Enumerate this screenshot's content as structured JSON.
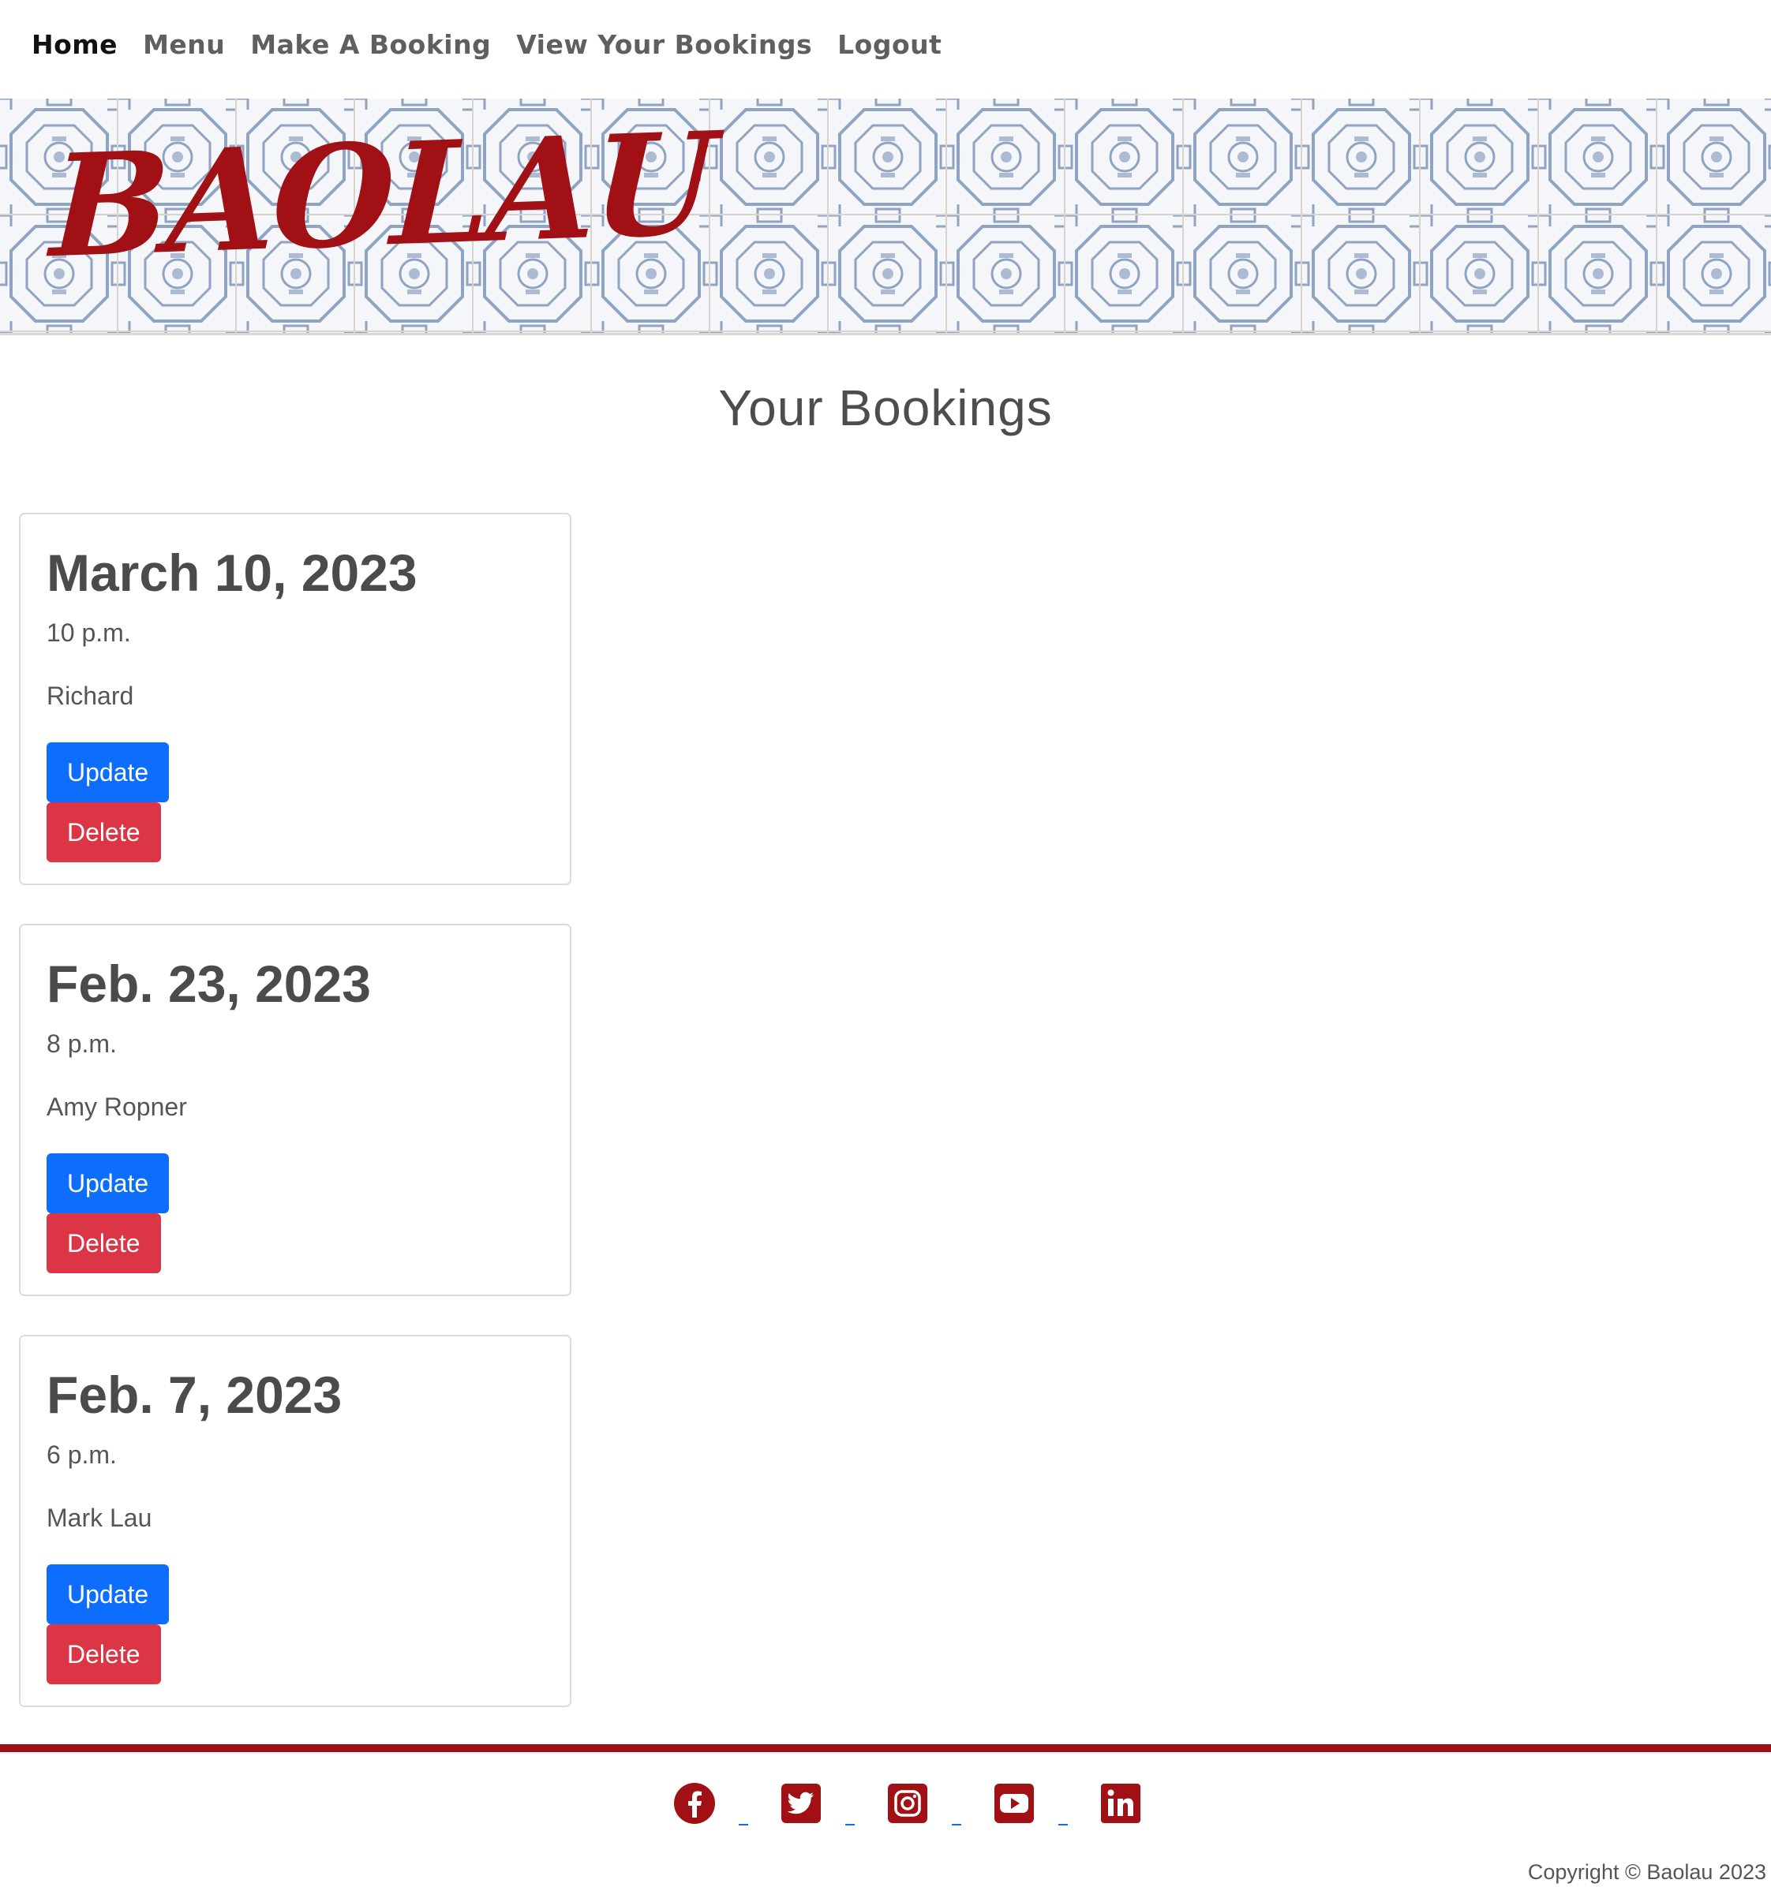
{
  "nav": {
    "items": [
      {
        "label": "Home",
        "active": true
      },
      {
        "label": "Menu",
        "active": false
      },
      {
        "label": "Make A Booking",
        "active": false
      },
      {
        "label": "View Your Bookings",
        "active": false
      },
      {
        "label": "Logout",
        "active": false
      }
    ]
  },
  "banner": {
    "logo_text": "BAOLAU",
    "logo_color": "#a01014",
    "tile_color": "#8fa3c2"
  },
  "main": {
    "title": "Your Bookings"
  },
  "bookings": [
    {
      "date": "March 10, 2023",
      "time": "10 p.m.",
      "name": "Richard",
      "update_label": "Update",
      "delete_label": "Delete"
    },
    {
      "date": "Feb. 23, 2023",
      "time": "8 p.m.",
      "name": "Amy Ropner",
      "update_label": "Update",
      "delete_label": "Delete"
    },
    {
      "date": "Feb. 7, 2023",
      "time": "6 p.m.",
      "name": "Mark Lau",
      "update_label": "Update",
      "delete_label": "Delete"
    }
  ],
  "colors": {
    "update_button": "#0d6efd",
    "delete_button": "#dc3545",
    "footer_rule": "#a01014",
    "social_icon": "#a01014"
  },
  "footer": {
    "socials": [
      {
        "icon": "facebook-icon"
      },
      {
        "icon": "twitter-icon"
      },
      {
        "icon": "instagram-icon"
      },
      {
        "icon": "youtube-icon"
      },
      {
        "icon": "linkedin-icon"
      }
    ],
    "copyright": "Copyright © Baolau 2023"
  }
}
